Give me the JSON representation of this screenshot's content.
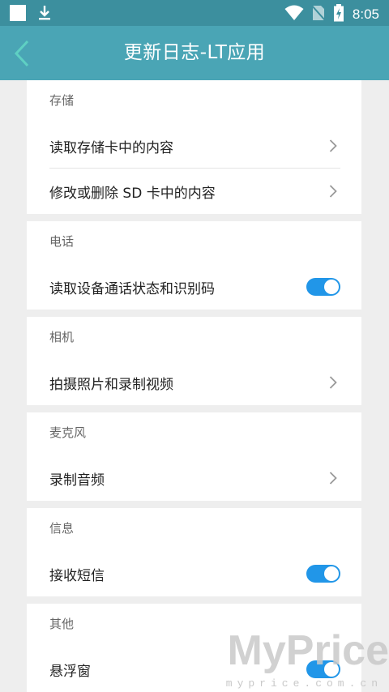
{
  "status_bar": {
    "time": "8:05",
    "icons": [
      "notification-square-icon",
      "download-icon",
      "wifi-icon",
      "no-sim-icon",
      "battery-charging-icon"
    ]
  },
  "app_bar": {
    "title": "更新日志-LT应用",
    "back_icon": "chevron-left-icon"
  },
  "sections": [
    {
      "title": "存储",
      "rows": [
        {
          "label": "读取存储卡中的内容",
          "control": "chevron"
        },
        {
          "label": "修改或删除 SD 卡中的内容",
          "control": "chevron"
        }
      ]
    },
    {
      "title": "电话",
      "rows": [
        {
          "label": "读取设备通话状态和识别码",
          "control": "toggle",
          "on": true
        }
      ]
    },
    {
      "title": "相机",
      "rows": [
        {
          "label": "拍摄照片和录制视频",
          "control": "chevron"
        }
      ]
    },
    {
      "title": "麦克风",
      "rows": [
        {
          "label": "录制音频",
          "control": "chevron"
        }
      ]
    },
    {
      "title": "信息",
      "rows": [
        {
          "label": "接收短信",
          "control": "toggle",
          "on": true
        }
      ]
    },
    {
      "title": "其他",
      "rows": [
        {
          "label": "悬浮窗",
          "control": "toggle",
          "on": true
        }
      ]
    }
  ],
  "colors": {
    "status_bar": "#3c8f9e",
    "app_bar": "#4aa5b5",
    "toggle_on": "#2196e8",
    "background": "#eeeeee"
  },
  "watermark": {
    "main": "MyPrice",
    "sub": "myprice.com.cn"
  }
}
